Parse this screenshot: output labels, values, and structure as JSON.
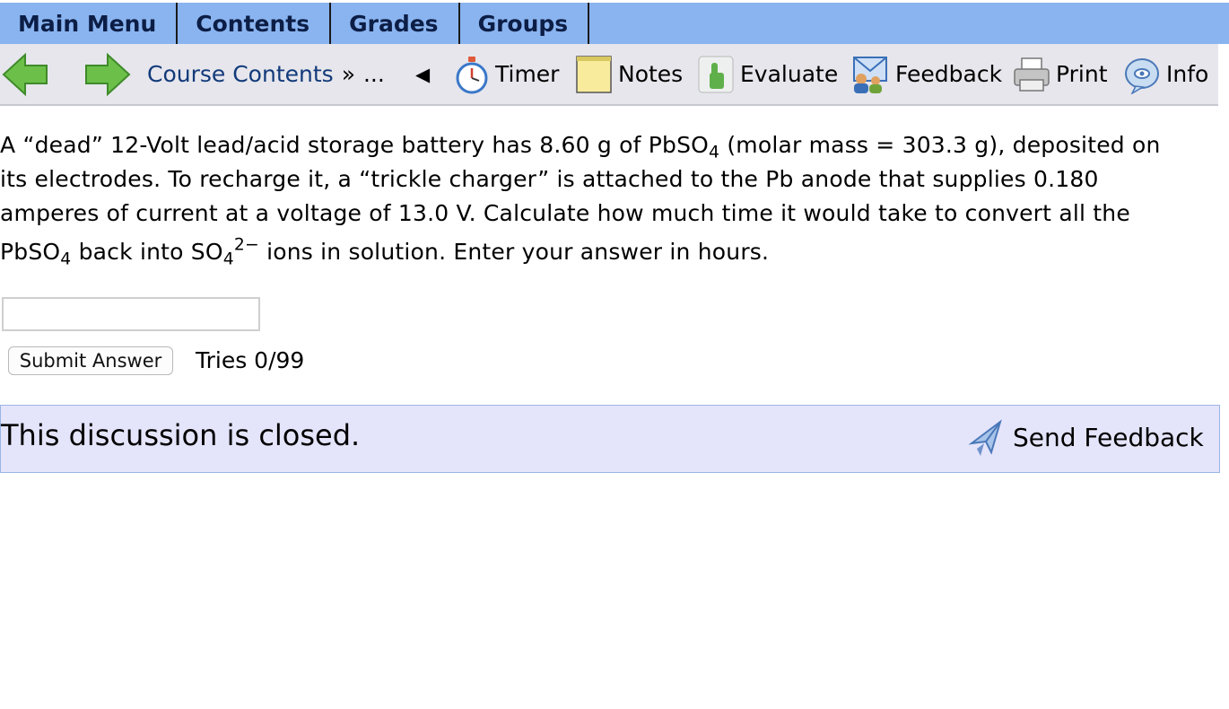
{
  "tabs": [
    {
      "label": "Main Menu"
    },
    {
      "label": "Contents"
    },
    {
      "label": "Grades"
    },
    {
      "label": "Groups"
    }
  ],
  "toolbar": {
    "breadcrumb": "Course Contents",
    "breadcrumb_sep": "»",
    "ellipsis": "...",
    "collapse_glyph": "◀",
    "timer": "Timer",
    "notes": "Notes",
    "evaluate": "Evaluate",
    "feedback": "Feedback",
    "print": "Print",
    "info": "Info"
  },
  "question": {
    "line1_a": "A “dead” 12-Volt lead/acid storage battery has 8.60 g of PbSO",
    "line1_sub": "4",
    "line1_b": " (molar mass = 303.3 g), deposited on",
    "line2": "its electrodes. To recharge it, a “trickle charger” is attached to the Pb anode that supplies 0.180",
    "line3": "amperes of current at a voltage of 13.0 V. Calculate how much time it would take to convert all the",
    "line4_a": "PbSO",
    "line4_sub1": "4",
    "line4_b": " back into SO",
    "line4_sub2": "4",
    "line4_sup": "2−",
    "line4_c": " ions in solution. Enter your answer in hours."
  },
  "answer": {
    "value": "",
    "placeholder": ""
  },
  "submit_label": "Submit Answer",
  "tries": "Tries 0/99",
  "discussion": {
    "status": "This discussion is closed.",
    "send_feedback": "Send Feedback"
  },
  "colors": {
    "tab_bar": "#8ab4f0",
    "tab_text": "#0c1e46",
    "toolbar_bg": "#e6e6ec",
    "discussion_bg": "#e4e4fb",
    "arrow_green": "#6cc04a"
  }
}
